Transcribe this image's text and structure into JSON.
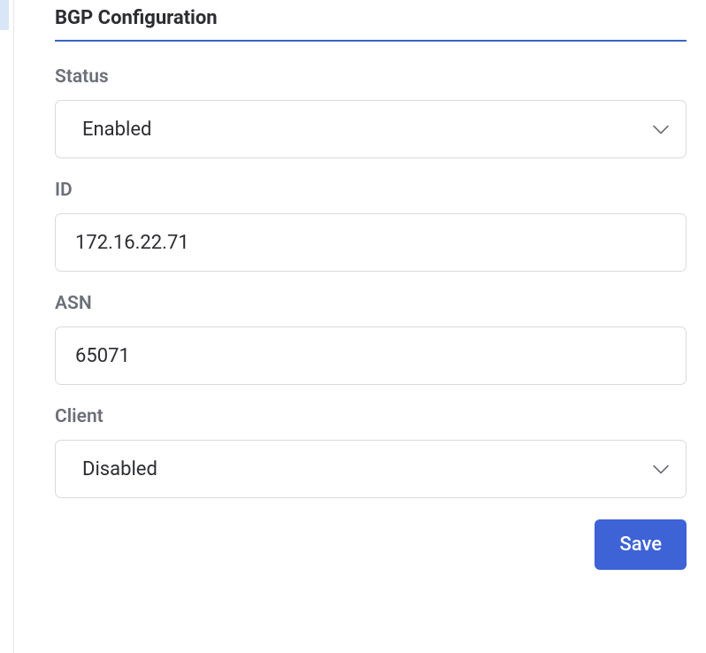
{
  "section": {
    "title": "BGP Configuration"
  },
  "fields": {
    "status": {
      "label": "Status",
      "value": "Enabled"
    },
    "id": {
      "label": "ID",
      "value": "172.16.22.71"
    },
    "asn": {
      "label": "ASN",
      "value": "65071"
    },
    "client": {
      "label": "Client",
      "value": "Disabled"
    }
  },
  "buttons": {
    "save": "Save"
  }
}
